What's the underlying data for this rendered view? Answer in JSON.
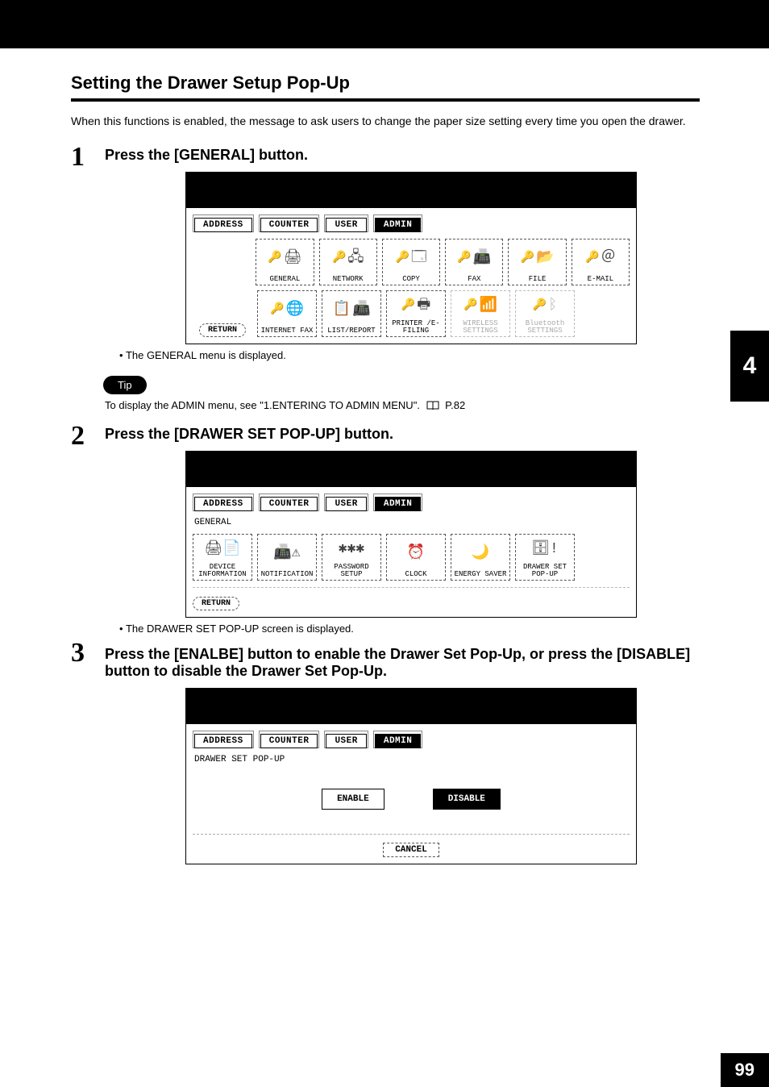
{
  "page": {
    "section_title": "Setting the Drawer Setup Pop-Up",
    "intro": "When this functions is enabled, the message to ask users to change the paper size setting every time you open the drawer.",
    "side_tab": "4",
    "page_number": "99"
  },
  "steps": {
    "s1": {
      "num": "1",
      "heading": "Press the [GENERAL] button.",
      "note": "The GENERAL menu is displayed."
    },
    "tip": {
      "label": "Tip",
      "text_a": "To display the ADMIN menu, see \"1.ENTERING TO ADMIN MENU\".  ",
      "text_b": " P.82"
    },
    "s2": {
      "num": "2",
      "heading": "Press the [DRAWER SET POP-UP] button.",
      "note": "The DRAWER SET POP-UP screen is displayed."
    },
    "s3": {
      "num": "3",
      "heading": "Press the [ENALBE] button to enable the Drawer Set Pop-Up, or press the [DISABLE] button to disable the Drawer Set Pop-Up."
    }
  },
  "panel_tabs": {
    "address": "ADDRESS",
    "counter": "COUNTER",
    "user": "USER",
    "admin": "ADMIN"
  },
  "panel1": {
    "return": "RETURN",
    "btns": {
      "general": "GENERAL",
      "network": "NETWORK",
      "copy": "COPY",
      "fax": "FAX",
      "file": "FILE",
      "email": "E-MAIL",
      "ifax": "INTERNET FAX",
      "list": "LIST/REPORT",
      "printer": "PRINTER /E-FILING",
      "wireless": "WIRELESS SETTINGS",
      "bluetooth": "Bluetooth SETTINGS"
    }
  },
  "panel2": {
    "breadcrumb": "GENERAL",
    "return": "RETURN",
    "btns": {
      "device": "DEVICE INFORMATION",
      "notif": "NOTIFICATION",
      "pwd": "PASSWORD SETUP",
      "clock": "CLOCK",
      "energy": "ENERGY SAVER",
      "drawer": "DRAWER SET POP-UP"
    }
  },
  "panel3": {
    "breadcrumb": "DRAWER SET POP-UP",
    "enable": "ENABLE",
    "disable": "DISABLE",
    "cancel": "CANCEL"
  }
}
